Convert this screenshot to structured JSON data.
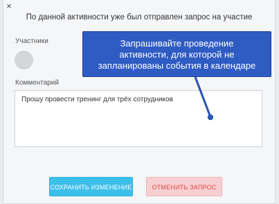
{
  "dialog": {
    "close_icon": "×",
    "notice": "По данной активности уже был отправлен запрос на участие",
    "participants_label": "Участники",
    "comment_label": "Комментарий",
    "comment_value": "Прошу провести тренинг для трёх сотрудников",
    "save_button": "СОХРАНИТЬ ИЗМЕНЕНИЕ",
    "cancel_button": "ОТМЕНИТЬ ЗАПРОС"
  },
  "callout": {
    "lines": [
      "Запрашивайте проведение",
      "активности, для которой не",
      "запланированы события в календаре"
    ]
  },
  "colors": {
    "save_bg": "#3cc0ea",
    "cancel_bg": "#f7cfd0",
    "cancel_text": "#e0484b",
    "callout_bg": "#2f5cc3"
  }
}
